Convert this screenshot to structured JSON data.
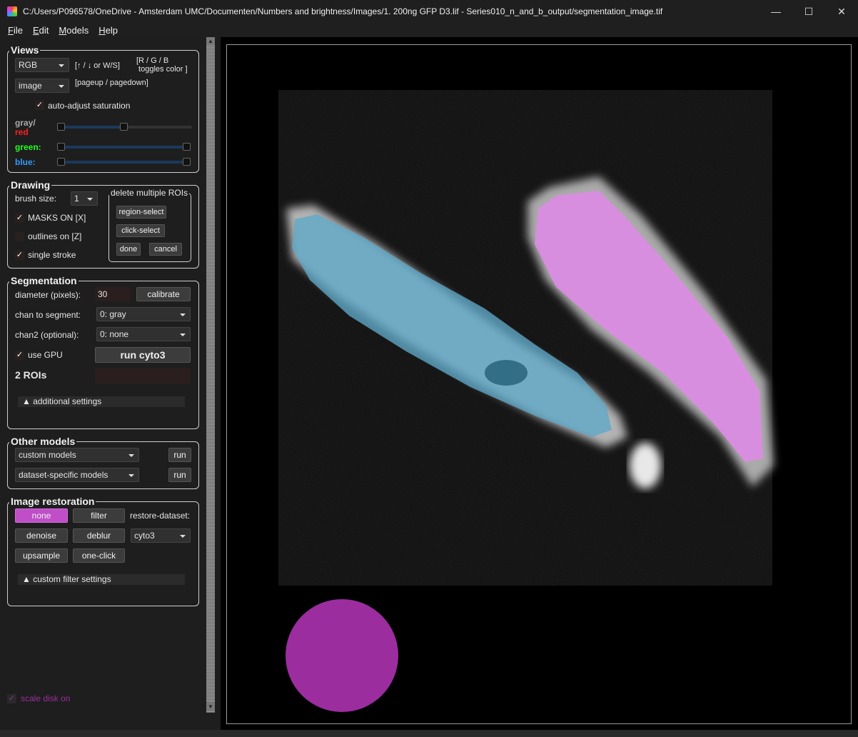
{
  "window": {
    "title": "C:/Users/P096578/OneDrive - Amsterdam UMC/Documenten/Numbers and brightness/Images/1. 200ng GFP D3.lif - Series010_n_and_b_output/segmentation_image.tif",
    "minimize": "—",
    "maximize": "☐",
    "close": "✕"
  },
  "menu": [
    "File",
    "Edit",
    "Models",
    "Help"
  ],
  "views": {
    "title": "Views",
    "color_mode": "RGB",
    "color_hint": "[↑ / ↓ or W/S]",
    "rgb_hint": "[R / G / B\n toggles color ]",
    "layer": "image",
    "layer_hint": "[pageup / pagedown]",
    "auto_adjust": "auto-adjust saturation",
    "auto_adjust_checked": true,
    "gray_label": "gray/",
    "red_label": "red",
    "green_label": "green:",
    "blue_label": "blue:",
    "gray_color": "#aaaaaa",
    "red_color": "#ff2020",
    "green_color": "#22ff22",
    "blue_color": "#3399ff"
  },
  "drawing": {
    "title": "Drawing",
    "brush_label": "brush size:",
    "brush_value": "1",
    "masks": "MASKS ON [X]",
    "masks_checked": true,
    "outlines": "outlines on [Z]",
    "outlines_checked": false,
    "single_stroke": "single stroke",
    "single_stroke_checked": true,
    "delete_group": "delete multiple ROIs",
    "region_select": "region-select",
    "click_select": "click-select",
    "done": "done",
    "cancel": "cancel"
  },
  "segmentation": {
    "title": "Segmentation",
    "diameter_label": "diameter (pixels):",
    "diameter_value": "30",
    "calibrate": "calibrate",
    "chan_label": "chan to segment:",
    "chan_value": "0: gray",
    "chan2_label": "chan2 (optional):",
    "chan2_value": "0: none",
    "gpu": "use GPU",
    "gpu_checked": true,
    "run": "run cyto3",
    "rois": "2 ROIs",
    "additional": "▲ additional settings"
  },
  "other_models": {
    "title": "Other models",
    "custom": "custom models",
    "dataset": "dataset-specific models",
    "run": "run"
  },
  "restoration": {
    "title": "Image restoration",
    "none": "none",
    "filter": "filter",
    "restore_label": "restore-dataset:",
    "denoise": "denoise",
    "deblur": "deblur",
    "dataset_value": "cyto3",
    "upsample": "upsample",
    "one_click": "one-click",
    "custom_filter": "▲ custom filter settings",
    "active_color": "#c04ec8"
  },
  "scale_disk": {
    "label": "scale disk on",
    "checked": true,
    "color": "#9b2d9f"
  },
  "viewer": {
    "mask1_color": "#5fa8c8",
    "mask2_color": "#e08ae8",
    "disk_color": "#9b2d9f"
  }
}
